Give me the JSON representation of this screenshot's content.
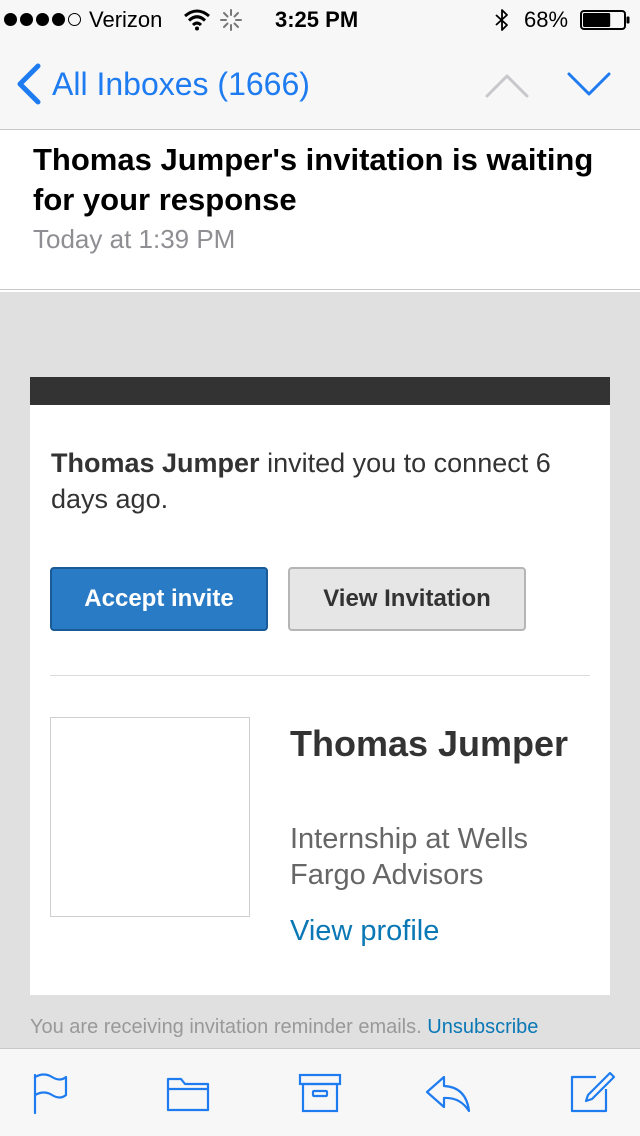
{
  "status_bar": {
    "carrier": "Verizon",
    "time": "3:25 PM",
    "battery_percent": "68%",
    "battery_level": 0.68,
    "signal_bars": 4,
    "signal_max": 5
  },
  "nav": {
    "back_label": "All Inboxes (1666)",
    "accent_color": "#1f7cf0",
    "up_icon": "chevron-up-icon",
    "down_icon": "chevron-down-icon"
  },
  "message": {
    "subject": "Thomas Jumper's invitation is waiting for your response",
    "date": "Today at 1:39 PM"
  },
  "email": {
    "inviter_name": "Thomas Jumper",
    "invite_text": " invited you to connect 6 days ago.",
    "accept_label": "Accept invite",
    "view_invitation_label": "View Invitation",
    "profile_name": "Thomas Jumper",
    "profile_headline": "Internship at Wells Fargo Advisors",
    "view_profile_label": "View profile",
    "footer_text": "You are receiving invitation reminder emails. ",
    "unsubscribe_label": "Unsubscribe",
    "primary_button_color": "#2a7bc6",
    "link_color": "#0a78b5"
  },
  "toolbar": {
    "icons": [
      "flag-icon",
      "folder-icon",
      "archive-icon",
      "reply-icon",
      "compose-icon"
    ]
  }
}
